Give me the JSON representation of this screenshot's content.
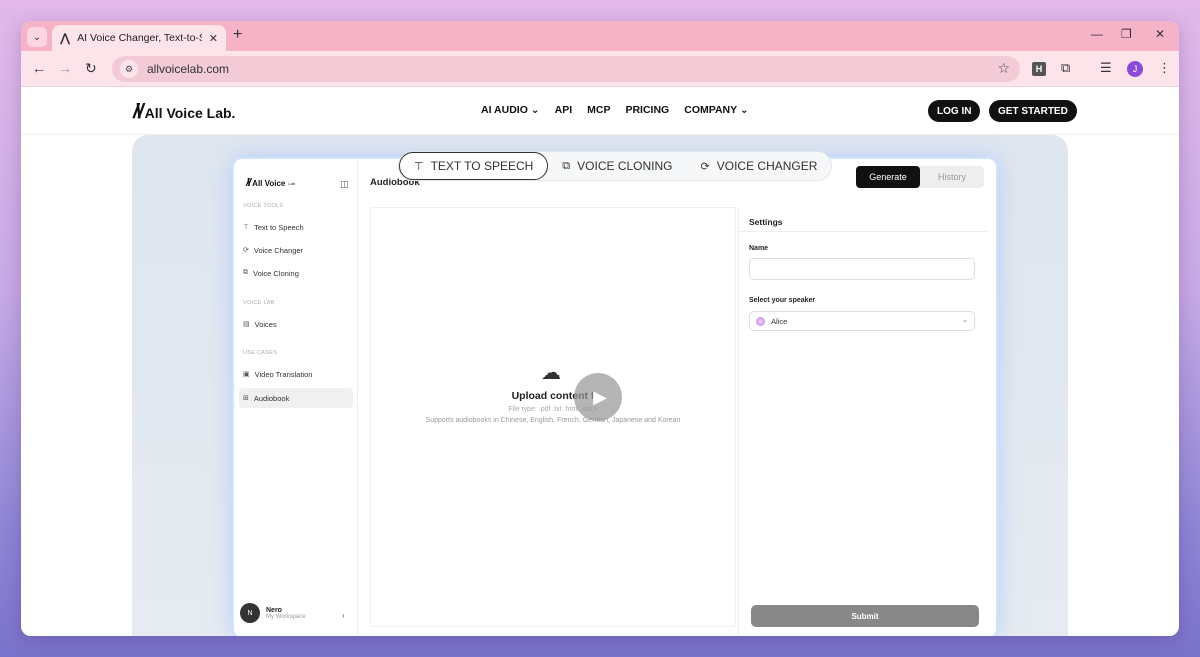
{
  "browser": {
    "tab_title": "AI Voice Changer, Text-to-Speech",
    "tab_close": "✕",
    "new_tab": "+",
    "url": "allvoicelab.com",
    "avatar_initial": "J",
    "ext_label": "H"
  },
  "site": {
    "logo_text": "All Voice Lab.",
    "nav": [
      {
        "label": "AI AUDIO",
        "has_dropdown": true
      },
      {
        "label": "API"
      },
      {
        "label": "MCP"
      },
      {
        "label": "PRICING"
      },
      {
        "label": "COMPANY",
        "has_dropdown": true
      }
    ],
    "login_label": "LOG IN",
    "get_started_label": "GET STARTED"
  },
  "app": {
    "mode_tabs": [
      "TEXT TO SPEECH",
      "VOICE CLONING",
      "VOICE CHANGER"
    ],
    "active_mode": "TEXT TO SPEECH",
    "sidebar": {
      "logo_text": "All Voice",
      "logo_suffix": "Lab",
      "sections": [
        {
          "title": "VOICE TOOLS",
          "items": [
            "Text to Speech",
            "Voice Changer",
            "Voice Cloning"
          ]
        },
        {
          "title": "VOICE LAB",
          "items": [
            "Voices"
          ]
        },
        {
          "title": "USE CASES",
          "items": [
            "Video Translation",
            "Audiobook"
          ]
        }
      ],
      "active_item": "Audiobook",
      "user": {
        "initial": "N",
        "name": "Nero",
        "workspace": "My Workspace"
      }
    },
    "main": {
      "title": "Audiobook",
      "generate_label": "Generate",
      "history_label": "History",
      "upload": {
        "title": "Upload content f",
        "file_types": "File type: .pdf .txt .html .docx",
        "support": "Supports audiobooks in Chinese, English, French, German, Japanese and Korean"
      }
    },
    "settings": {
      "title": "Settings",
      "name_label": "Name",
      "name_value": "",
      "speaker_label": "Select your speaker",
      "speaker_value": "Alice",
      "submit_label": "Submit"
    }
  },
  "colors": {
    "tab_strip": "#f6b3c8",
    "toolbar": "#fde3ea",
    "accent_dark": "#111111"
  }
}
